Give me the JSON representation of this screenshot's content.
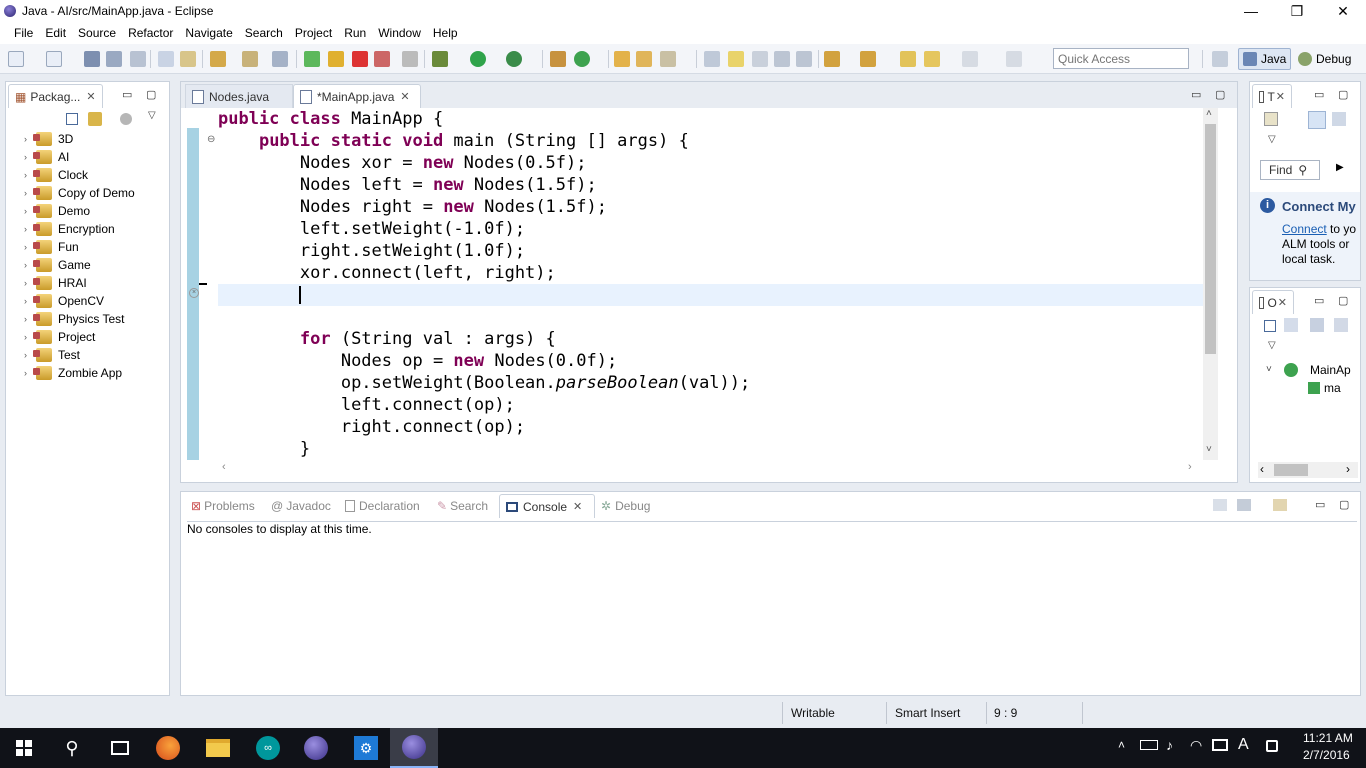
{
  "window": {
    "title": "Java - AI/src/MainApp.java - Eclipse",
    "min": "—",
    "restore": "❐",
    "close": "✕"
  },
  "menu": [
    "File",
    "Edit",
    "Source",
    "Refactor",
    "Navigate",
    "Search",
    "Project",
    "Run",
    "Window",
    "Help"
  ],
  "toolbar": {
    "quick_access_placeholder": "Quick Access"
  },
  "perspectives": {
    "java": "Java",
    "debug": "Debug"
  },
  "package_explorer": {
    "tab_label": "Packag...",
    "projects": [
      "3D",
      "AI",
      "Clock",
      "Copy of Demo",
      "Demo",
      "Encryption",
      "Fun",
      "Game",
      "HRAI",
      "OpenCV",
      "Physics Test",
      "Project",
      "Test",
      "Zombie App"
    ]
  },
  "editor": {
    "tabs": [
      {
        "label": "Nodes.java"
      },
      {
        "label": "*MainApp.java"
      }
    ],
    "code": {
      "l1_kw": "public class",
      "l1_rest": " MainApp {",
      "l2_kw": "public static void",
      "l2_rest": " main (String [] args) {",
      "l3_a": "Nodes xor = ",
      "l3_kw": "new",
      "l3_b": " Nodes(0.5f);",
      "l4_a": "Nodes left = ",
      "l4_kw": "new",
      "l4_b": " Nodes(1.5f);",
      "l5_a": "Nodes right = ",
      "l5_kw": "new",
      "l5_b": " Nodes(1.5f);",
      "l6": "left.setWeight(-1.0f);",
      "l7": "right.setWeight(1.0f);",
      "l8": "xor.connect(left, right);",
      "l11_kw": "for",
      "l11_rest": " (String val : args) {",
      "l12_a": "Nodes op = ",
      "l12_kw": "new",
      "l12_b": " Nodes(0.0f);",
      "l13_a": "op.setWeight(Boolean.",
      "l13_i": "parseBoolean",
      "l13_b": "(val));",
      "l14": "left.connect(op);",
      "l15": "right.connect(op);",
      "l16": "}"
    }
  },
  "task_list": {
    "tab_label": "T",
    "find_placeholder": "Find",
    "connect_title": "Connect My",
    "connect_link": "Connect",
    "connect_text1": "to yo",
    "connect_text2": "ALM tools or",
    "connect_text3": "local task."
  },
  "outline": {
    "tab_label": "O",
    "item1": "MainAp",
    "item2": "ma"
  },
  "bottom": {
    "tabs": [
      "Problems",
      "Javadoc",
      "Declaration",
      "Search",
      "Console",
      "Debug"
    ],
    "console_message": "No consoles to display at this time."
  },
  "status": {
    "writable": "Writable",
    "insert_mode": "Smart Insert",
    "position": "9 : 9"
  },
  "taskbar": {
    "time": "11:21 AM",
    "date": "2/7/2016",
    "ime": "A"
  }
}
